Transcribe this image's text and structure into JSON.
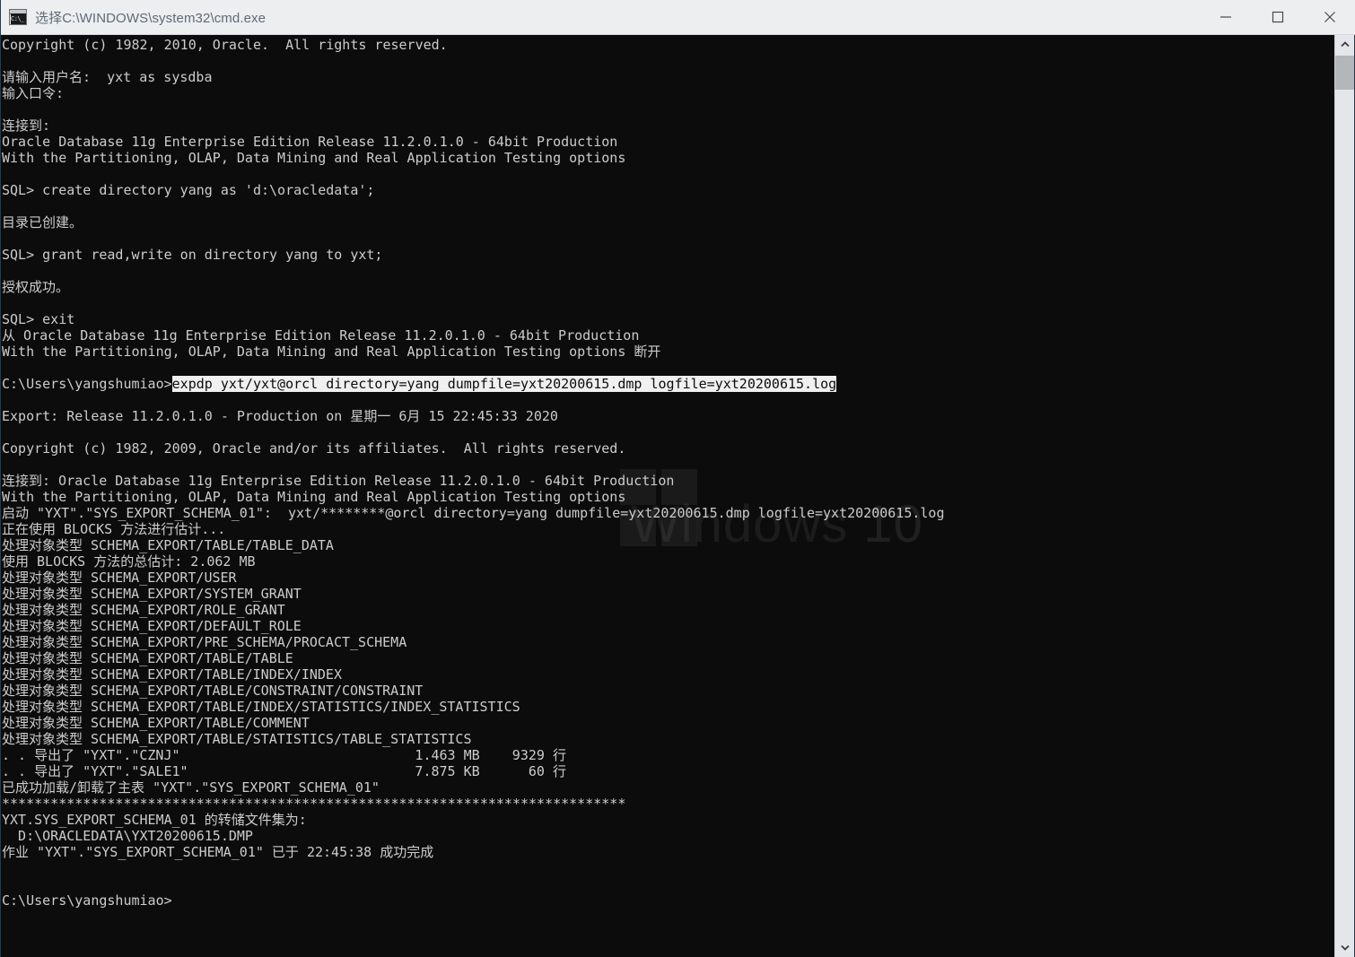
{
  "titlebar": {
    "title": "选择C:\\WINDOWS\\system32\\cmd.exe",
    "icon": "cmd-console-icon",
    "minimize_label": "—",
    "maximize_label": "□",
    "close_label": "✕"
  },
  "watermark": {
    "line1": "Windows",
    "line2": "10"
  },
  "colors": {
    "terminal_bg": "#0c0c0c",
    "terminal_fg": "#cccccc",
    "titlebar_bg": "#eceef0",
    "titlebar_fg": "#5f6b78",
    "selection_bg": "#f0f0f0",
    "selection_fg": "#0c0c0c",
    "scrollbar_track": "#e4e6e9",
    "scrollbar_thumb": "#b4b7ba"
  },
  "selection": {
    "prompt": "C:\\Users\\yangshumiao>",
    "selected_command": "expdp yxt/yxt@orcl directory=yang dumpfile=yxt20200615.dmp logfile=yxt20200615.log"
  },
  "console": {
    "lines": [
      "Copyright (c) 1982, 2010, Oracle.  All rights reserved.",
      "",
      "请输入用户名:  yxt as sysdba",
      "输入口令:",
      "",
      "连接到:",
      "Oracle Database 11g Enterprise Edition Release 11.2.0.1.0 - 64bit Production",
      "With the Partitioning, OLAP, Data Mining and Real Application Testing options",
      "",
      "SQL> create directory yang as 'd:\\oracledata';",
      "",
      "目录已创建。",
      "",
      "SQL> grant read,write on directory yang to yxt;",
      "",
      "授权成功。",
      "",
      "SQL> exit",
      "从 Oracle Database 11g Enterprise Edition Release 11.2.0.1.0 - 64bit Production",
      "With the Partitioning, OLAP, Data Mining and Real Application Testing options 断开",
      "",
      "__SELECTION_LINE__",
      "",
      "Export: Release 11.2.0.1.0 - Production on 星期一 6月 15 22:45:33 2020",
      "",
      "Copyright (c) 1982, 2009, Oracle and/or its affiliates.  All rights reserved.",
      "",
      "连接到: Oracle Database 11g Enterprise Edition Release 11.2.0.1.0 - 64bit Production",
      "With the Partitioning, OLAP, Data Mining and Real Application Testing options",
      "启动 \"YXT\".\"SYS_EXPORT_SCHEMA_01\":  yxt/********@orcl directory=yang dumpfile=yxt20200615.dmp logfile=yxt20200615.log",
      "正在使用 BLOCKS 方法进行估计...",
      "处理对象类型 SCHEMA_EXPORT/TABLE/TABLE_DATA",
      "使用 BLOCKS 方法的总估计: 2.062 MB",
      "处理对象类型 SCHEMA_EXPORT/USER",
      "处理对象类型 SCHEMA_EXPORT/SYSTEM_GRANT",
      "处理对象类型 SCHEMA_EXPORT/ROLE_GRANT",
      "处理对象类型 SCHEMA_EXPORT/DEFAULT_ROLE",
      "处理对象类型 SCHEMA_EXPORT/PRE_SCHEMA/PROCACT_SCHEMA",
      "处理对象类型 SCHEMA_EXPORT/TABLE/TABLE",
      "处理对象类型 SCHEMA_EXPORT/TABLE/INDEX/INDEX",
      "处理对象类型 SCHEMA_EXPORT/TABLE/CONSTRAINT/CONSTRAINT",
      "处理对象类型 SCHEMA_EXPORT/TABLE/INDEX/STATISTICS/INDEX_STATISTICS",
      "处理对象类型 SCHEMA_EXPORT/TABLE/COMMENT",
      "处理对象类型 SCHEMA_EXPORT/TABLE/STATISTICS/TABLE_STATISTICS",
      ". . 导出了 \"YXT\".\"CZNJ\"                             1.463 MB    9329 行",
      ". . 导出了 \"YXT\".\"SALE1\"                            7.875 KB      60 行",
      "已成功加载/卸载了主表 \"YXT\".\"SYS_EXPORT_SCHEMA_01\"",
      "*****************************************************************************",
      "YXT.SYS_EXPORT_SCHEMA_01 的转储文件集为:",
      "  D:\\ORACLEDATA\\YXT20200615.DMP",
      "作业 \"YXT\".\"SYS_EXPORT_SCHEMA_01\" 已于 22:45:38 成功完成",
      "",
      "",
      "C:\\Users\\yangshumiao>"
    ],
    "exported_tables": [
      {
        "name": "\"YXT\".\"CZNJ\"",
        "size": "1.463 MB",
        "rows": "9329 行"
      },
      {
        "name": "\"YXT\".\"SALE1\"",
        "size": "7.875 KB",
        "rows": "60 行"
      }
    ],
    "dump_file": "D:\\ORACLEDATA\\YXT20200615.DMP",
    "job_name": "\"YXT\".\"SYS_EXPORT_SCHEMA_01\"",
    "job_finish_time": "22:45:38",
    "total_estimate": "2.062 MB",
    "export_release": "11.2.0.1.0",
    "export_timestamp": "星期一 6月 15 22:45:33 2020"
  },
  "scrollbar": {
    "up_arrow": "scroll-up-arrow-icon",
    "down_arrow": "scroll-down-arrow-icon"
  }
}
